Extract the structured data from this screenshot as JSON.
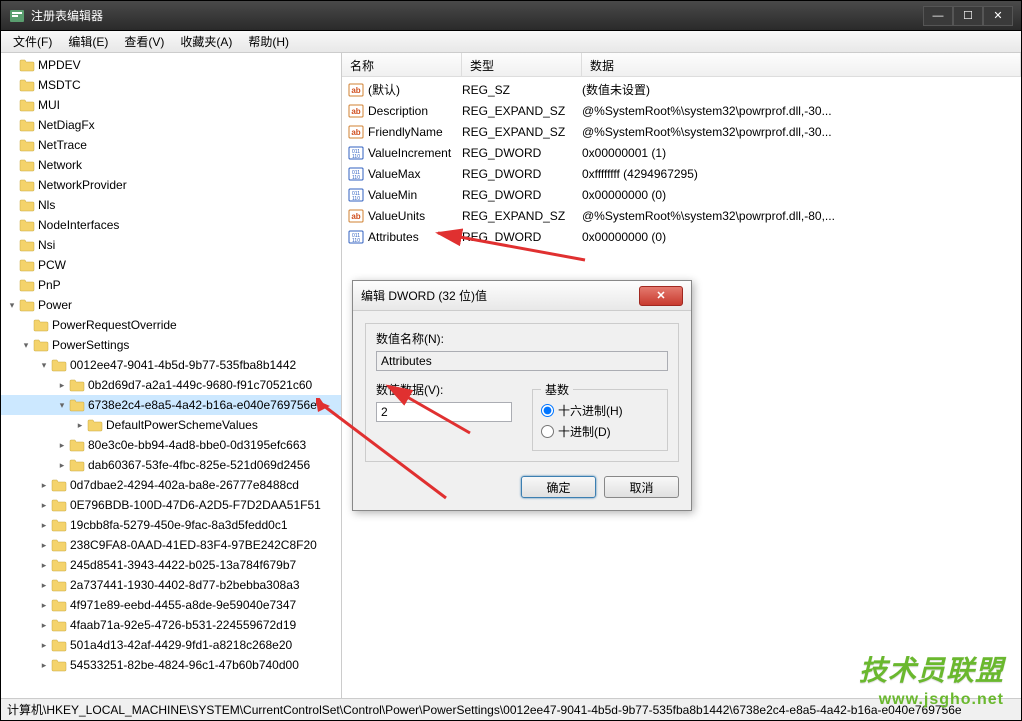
{
  "window": {
    "title": "注册表编辑器"
  },
  "menu": {
    "file": "文件(F)",
    "edit": "编辑(E)",
    "view": "查看(V)",
    "favorites": "收藏夹(A)",
    "help": "帮助(H)"
  },
  "tree": [
    {
      "label": "MPDEV",
      "indent": 0,
      "exp": ""
    },
    {
      "label": "MSDTC",
      "indent": 0,
      "exp": ""
    },
    {
      "label": "MUI",
      "indent": 0,
      "exp": ""
    },
    {
      "label": "NetDiagFx",
      "indent": 0,
      "exp": ""
    },
    {
      "label": "NetTrace",
      "indent": 0,
      "exp": ""
    },
    {
      "label": "Network",
      "indent": 0,
      "exp": ""
    },
    {
      "label": "NetworkProvider",
      "indent": 0,
      "exp": ""
    },
    {
      "label": "Nls",
      "indent": 0,
      "exp": ""
    },
    {
      "label": "NodeInterfaces",
      "indent": 0,
      "exp": ""
    },
    {
      "label": "Nsi",
      "indent": 0,
      "exp": ""
    },
    {
      "label": "PCW",
      "indent": 0,
      "exp": ""
    },
    {
      "label": "PnP",
      "indent": 0,
      "exp": ""
    },
    {
      "label": "Power",
      "indent": 0,
      "exp": "▾"
    },
    {
      "label": "PowerRequestOverride",
      "indent": 1,
      "exp": ""
    },
    {
      "label": "PowerSettings",
      "indent": 1,
      "exp": "▾"
    },
    {
      "label": "0012ee47-9041-4b5d-9b77-535fba8b1442",
      "indent": 2,
      "exp": "▾"
    },
    {
      "label": "0b2d69d7-a2a1-449c-9680-f91c70521c60",
      "indent": 3,
      "exp": "▸"
    },
    {
      "label": "6738e2c4-e8a5-4a42-b16a-e040e769756e",
      "indent": 3,
      "exp": "▾",
      "selected": true
    },
    {
      "label": "DefaultPowerSchemeValues",
      "indent": 4,
      "exp": "▸"
    },
    {
      "label": "80e3c0e-bb94-4ad8-bbe0-0d3195efc663",
      "indent": 3,
      "exp": "▸"
    },
    {
      "label": "dab60367-53fe-4fbc-825e-521d069d2456",
      "indent": 3,
      "exp": "▸"
    },
    {
      "label": "0d7dbae2-4294-402a-ba8e-26777e8488cd",
      "indent": 2,
      "exp": "▸"
    },
    {
      "label": "0E796BDB-100D-47D6-A2D5-F7D2DAA51F51",
      "indent": 2,
      "exp": "▸"
    },
    {
      "label": "19cbb8fa-5279-450e-9fac-8a3d5fedd0c1",
      "indent": 2,
      "exp": "▸"
    },
    {
      "label": "238C9FA8-0AAD-41ED-83F4-97BE242C8F20",
      "indent": 2,
      "exp": "▸"
    },
    {
      "label": "245d8541-3943-4422-b025-13a784f679b7",
      "indent": 2,
      "exp": "▸"
    },
    {
      "label": "2a737441-1930-4402-8d77-b2bebba308a3",
      "indent": 2,
      "exp": "▸"
    },
    {
      "label": "4f971e89-eebd-4455-a8de-9e59040e7347",
      "indent": 2,
      "exp": "▸"
    },
    {
      "label": "4faab71a-92e5-4726-b531-224559672d19",
      "indent": 2,
      "exp": "▸"
    },
    {
      "label": "501a4d13-42af-4429-9fd1-a8218c268e20",
      "indent": 2,
      "exp": "▸"
    },
    {
      "label": "54533251-82be-4824-96c1-47b60b740d00",
      "indent": 2,
      "exp": "▸"
    }
  ],
  "list": {
    "headers": {
      "name": "名称",
      "type": "类型",
      "data": "数据"
    },
    "rows": [
      {
        "icon": "ab",
        "name": "(默认)",
        "type": "REG_SZ",
        "data": "(数值未设置)"
      },
      {
        "icon": "ab",
        "name": "Description",
        "type": "REG_EXPAND_SZ",
        "data": "@%SystemRoot%\\system32\\powrprof.dll,-30..."
      },
      {
        "icon": "ab",
        "name": "FriendlyName",
        "type": "REG_EXPAND_SZ",
        "data": "@%SystemRoot%\\system32\\powrprof.dll,-30..."
      },
      {
        "icon": "bin",
        "name": "ValueIncrement",
        "type": "REG_DWORD",
        "data": "0x00000001 (1)"
      },
      {
        "icon": "bin",
        "name": "ValueMax",
        "type": "REG_DWORD",
        "data": "0xffffffff (4294967295)"
      },
      {
        "icon": "bin",
        "name": "ValueMin",
        "type": "REG_DWORD",
        "data": "0x00000000 (0)"
      },
      {
        "icon": "ab",
        "name": "ValueUnits",
        "type": "REG_EXPAND_SZ",
        "data": "@%SystemRoot%\\system32\\powrprof.dll,-80,..."
      },
      {
        "icon": "bin",
        "name": "Attributes",
        "type": "REG_DWORD",
        "data": "0x00000000 (0)"
      }
    ]
  },
  "dialog": {
    "title": "编辑 DWORD (32 位)值",
    "name_label": "数值名称(N):",
    "name_value": "Attributes",
    "data_label": "数值数据(V):",
    "data_value": "2",
    "base_label": "基数",
    "hex_label": "十六进制(H)",
    "dec_label": "十进制(D)",
    "ok": "确定",
    "cancel": "取消"
  },
  "statusbar": {
    "path": "计算机\\HKEY_LOCAL_MACHINE\\SYSTEM\\CurrentControlSet\\Control\\Power\\PowerSettings\\0012ee47-9041-4b5d-9b77-535fba8b1442\\6738e2c4-e8a5-4a42-b16a-e040e769756e"
  },
  "watermark": {
    "line1": "技术员联盟",
    "line2": "www.jsgho.net"
  }
}
